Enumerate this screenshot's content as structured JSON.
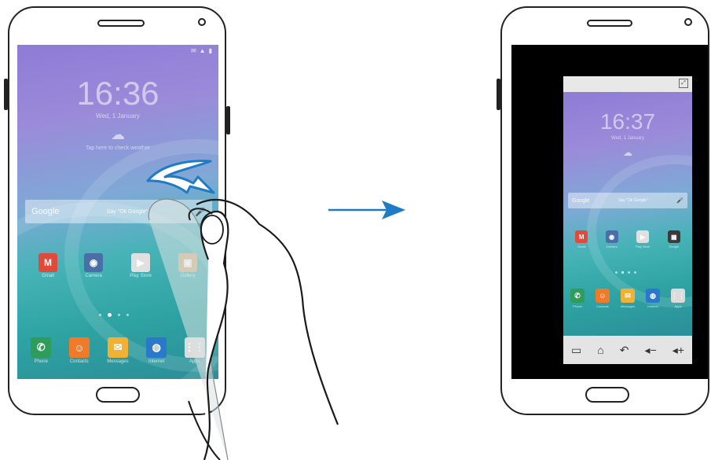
{
  "left_screen": {
    "clock": "16:36",
    "date": "Wed, 1 January",
    "weather": "Tap here to check weather",
    "google_label": "Google",
    "google_hint": "Say \"Ok Google\"",
    "apps": [
      {
        "label": "Gmail",
        "icon": "gmail-icon",
        "color": "#e04a3b"
      },
      {
        "label": "Camera",
        "icon": "camera-icon",
        "color": "#4c6ea8"
      },
      {
        "label": "Play Store",
        "icon": "play-store-icon",
        "color": "#e0e0e0"
      },
      {
        "label": "Gallery",
        "icon": "gallery-icon",
        "color": "#c8b080"
      }
    ],
    "dock": [
      {
        "label": "Phone",
        "icon": "phone-icon",
        "color": "#2e9c5a"
      },
      {
        "label": "Contacts",
        "icon": "contacts-icon",
        "color": "#ef7b2a"
      },
      {
        "label": "Messages",
        "icon": "messages-icon",
        "color": "#f1b134"
      },
      {
        "label": "Internet",
        "icon": "internet-icon",
        "color": "#2a78c9"
      },
      {
        "label": "Apps",
        "icon": "apps-icon",
        "color": "#dcdcdc"
      }
    ]
  },
  "right_screen": {
    "clock": "16:37",
    "date": "Wed, 1 January",
    "google_label": "Google",
    "google_hint": "Say \"Ok Google\"",
    "apps": [
      {
        "label": "Gmail",
        "icon": "gmail-icon",
        "color": "#e04a3b"
      },
      {
        "label": "Camera",
        "icon": "camera-icon",
        "color": "#4c6ea8"
      },
      {
        "label": "Play Store",
        "icon": "play-store-icon",
        "color": "#e0e0e0"
      },
      {
        "label": "Google",
        "icon": "google-folder-icon",
        "color": "#3b3b3b"
      }
    ],
    "dock": [
      {
        "label": "Phone",
        "icon": "phone-icon",
        "color": "#2e9c5a"
      },
      {
        "label": "Contacts",
        "icon": "contacts-icon",
        "color": "#ef7b2a"
      },
      {
        "label": "Messages",
        "icon": "messages-icon",
        "color": "#f1b134"
      },
      {
        "label": "Internet",
        "icon": "internet-icon",
        "color": "#2a78c9"
      },
      {
        "label": "Apps",
        "icon": "apps-icon",
        "color": "#dcdcdc"
      }
    ],
    "nav_buttons": [
      {
        "name": "recent-apps-icon",
        "glyph": "▭"
      },
      {
        "name": "home-icon",
        "glyph": "⌂"
      },
      {
        "name": "back-icon",
        "glyph": "↶"
      },
      {
        "name": "volume-down-icon",
        "glyph": "◂−"
      },
      {
        "name": "volume-up-icon",
        "glyph": "◂+"
      }
    ]
  },
  "colors": {
    "arrow": "#1e7bc4",
    "swipe_arrow": "#1e7bc4"
  }
}
